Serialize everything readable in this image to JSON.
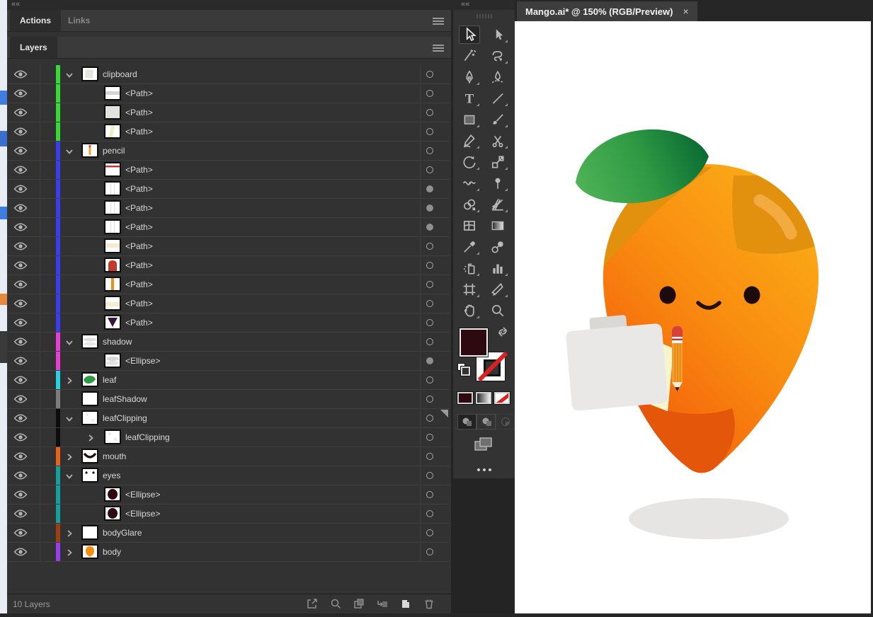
{
  "chrome": {
    "collapse_icon": "««",
    "actions_tab": "Actions",
    "links_tab": "Links",
    "layers_tab": "Layers",
    "layer_count": "10 Layers",
    "doc_tab_title": "Mango.ai* @ 150% (RGB/Preview)",
    "doc_tab_close": "×",
    "doc_zoom": "150%",
    "doc_color_mode": "RGB/Preview"
  },
  "layers_panel": {
    "rows": [
      {
        "label": "clipboard",
        "indent": 0,
        "expander": "open",
        "thumb": "clipboard",
        "color": "#35da35",
        "target": "hollow"
      },
      {
        "label": "<Path>",
        "indent": 1,
        "expander": null,
        "thumb": "band-gray",
        "color": "#35da35",
        "target": "hollow"
      },
      {
        "label": "<Path>",
        "indent": 1,
        "expander": null,
        "thumb": "fill-light",
        "color": "#35da35",
        "target": "hollow"
      },
      {
        "label": "<Path>",
        "indent": 1,
        "expander": null,
        "thumb": "diag-cream",
        "color": "#35da35",
        "target": "hollow"
      },
      {
        "label": "pencil",
        "indent": 0,
        "expander": "open",
        "thumb": "pencil",
        "color": "#3c3cf2",
        "target": "hollow"
      },
      {
        "label": "<Path>",
        "indent": 1,
        "expander": null,
        "thumb": "red-line",
        "color": "#3c3cf2",
        "target": "hollow"
      },
      {
        "label": "<Path>",
        "indent": 1,
        "expander": null,
        "thumb": "vlines",
        "color": "#3c3cf2",
        "target": "filled"
      },
      {
        "label": "<Path>",
        "indent": 1,
        "expander": null,
        "thumb": "vlines",
        "color": "#3c3cf2",
        "target": "filled"
      },
      {
        "label": "<Path>",
        "indent": 1,
        "expander": null,
        "thumb": "vlines",
        "color": "#3c3cf2",
        "target": "filled"
      },
      {
        "label": "<Path>",
        "indent": 1,
        "expander": null,
        "thumb": "cream-band",
        "color": "#3c3cf2",
        "target": "hollow"
      },
      {
        "label": "<Path>",
        "indent": 1,
        "expander": null,
        "thumb": "red-dome",
        "color": "#3c3cf2",
        "target": "hollow"
      },
      {
        "label": "<Path>",
        "indent": 1,
        "expander": null,
        "thumb": "orange-stripe",
        "color": "#3c3cf2",
        "target": "hollow"
      },
      {
        "label": "<Path>",
        "indent": 1,
        "expander": null,
        "thumb": "cream-band2",
        "color": "#3c3cf2",
        "target": "hollow"
      },
      {
        "label": "<Path>",
        "indent": 1,
        "expander": null,
        "thumb": "purple-tri",
        "color": "#3c3cf2",
        "target": "hollow"
      },
      {
        "label": "shadow",
        "indent": 0,
        "expander": "open",
        "thumb": "shadow-band",
        "color": "#ee3cd8",
        "target": "hollow"
      },
      {
        "label": "<Ellipse>",
        "indent": 1,
        "expander": null,
        "thumb": "gray-ellipse",
        "color": "#ee3cd8",
        "target": "filled"
      },
      {
        "label": "leaf",
        "indent": 0,
        "expander": "closed",
        "thumb": "leaf",
        "color": "#24d4e4",
        "target": "hollow"
      },
      {
        "label": "leafShadow",
        "indent": 0,
        "expander": null,
        "thumb": "white",
        "color": "#7d7d7d",
        "target": "hollow"
      },
      {
        "label": "leafClipping",
        "indent": 0,
        "expander": "open",
        "thumb": "faint",
        "color": "#0d0d0d",
        "target": "hollow",
        "selected": true
      },
      {
        "label": "leafClipping",
        "indent": 1,
        "expander": "closed",
        "thumb": "faint",
        "color": "#0d0d0d",
        "target": "hollow"
      },
      {
        "label": "mouth",
        "indent": 0,
        "expander": "closed",
        "thumb": "mouth",
        "color": "#ee6118",
        "target": "hollow"
      },
      {
        "label": "eyes",
        "indent": 0,
        "expander": "open",
        "thumb": "eyes",
        "color": "#12a0a0",
        "target": "hollow"
      },
      {
        "label": "<Ellipse>",
        "indent": 1,
        "expander": null,
        "thumb": "dark-ellipse",
        "color": "#12a0a0",
        "target": "hollow"
      },
      {
        "label": "<Ellipse>",
        "indent": 1,
        "expander": null,
        "thumb": "dark-ellipse",
        "color": "#12a0a0",
        "target": "hollow"
      },
      {
        "label": "bodyGlare",
        "indent": 0,
        "expander": "closed",
        "thumb": "white",
        "color": "#a04012",
        "target": "hollow"
      },
      {
        "label": "body",
        "indent": 0,
        "expander": "closed",
        "thumb": "mango",
        "color": "#9a3cf0",
        "target": "hollow"
      }
    ],
    "footer_icons": [
      "collect-for-export",
      "locate-object",
      "make-clipping-mask",
      "create-new-sublayer",
      "create-new-layer",
      "delete-selection"
    ]
  },
  "toolbar": {
    "active_tool": "selection",
    "tools": [
      {
        "name": "selection",
        "corner": false
      },
      {
        "name": "direct-selection",
        "corner": true
      },
      {
        "name": "magic-wand",
        "corner": false
      },
      {
        "name": "lasso",
        "corner": true
      },
      {
        "name": "pen",
        "corner": true
      },
      {
        "name": "curvature",
        "corner": false
      },
      {
        "name": "type",
        "corner": true
      },
      {
        "name": "line-segment",
        "corner": true
      },
      {
        "name": "rectangle",
        "corner": true
      },
      {
        "name": "paintbrush",
        "corner": true
      },
      {
        "name": "shaper",
        "corner": true
      },
      {
        "name": "scissors",
        "corner": true
      },
      {
        "name": "rotate",
        "corner": true
      },
      {
        "name": "scale",
        "corner": true
      },
      {
        "name": "width",
        "corner": true
      },
      {
        "name": "puppet-warp",
        "corner": true
      },
      {
        "name": "shape-builder",
        "corner": true
      },
      {
        "name": "perspective-grid",
        "corner": true
      },
      {
        "name": "mesh",
        "corner": false
      },
      {
        "name": "gradient",
        "corner": false
      },
      {
        "name": "eyedropper",
        "corner": true
      },
      {
        "name": "blend",
        "corner": false
      },
      {
        "name": "symbol-sprayer",
        "corner": true
      },
      {
        "name": "column-graph",
        "corner": true
      },
      {
        "name": "artboard",
        "corner": true
      },
      {
        "name": "slice",
        "corner": true
      },
      {
        "name": "hand",
        "corner": true
      },
      {
        "name": "zoom",
        "corner": false
      }
    ],
    "fill_color": "#2e0a10",
    "stroke_style": "none",
    "color_buttons": [
      "color",
      "gradient",
      "none"
    ],
    "mode_buttons": [
      "draw-normal",
      "draw-behind",
      "draw-inside"
    ],
    "more_label": "..."
  },
  "illustration": {
    "colors": {
      "body_bottom": "#f3590a",
      "body_mid": "#f98d10",
      "body_top": "#fbab17",
      "body_shade": "#e2910e",
      "shade_highlight": "#f3ab3f",
      "bottom_shade": "#e4560a",
      "leaf_light": "#4db155",
      "leaf_mid": "#2f9a44",
      "leaf_dark": "#0a6b33",
      "eye": "#1c0a0d",
      "mouth": "#241010",
      "clipboard": "#e9e8e6",
      "clip_tab": "#d9d8d5",
      "paper": "#f6f5cc",
      "pencil_body": "#f59d2b",
      "pencil_stripe": "#e0861a",
      "eraser": "#d84038",
      "ferrule": "#f8f8f8",
      "ferrule_line": "#cc3333",
      "wood": "#f5eecb",
      "tip": "#2c1440",
      "ground_shadow": "#e7e5e3"
    }
  }
}
